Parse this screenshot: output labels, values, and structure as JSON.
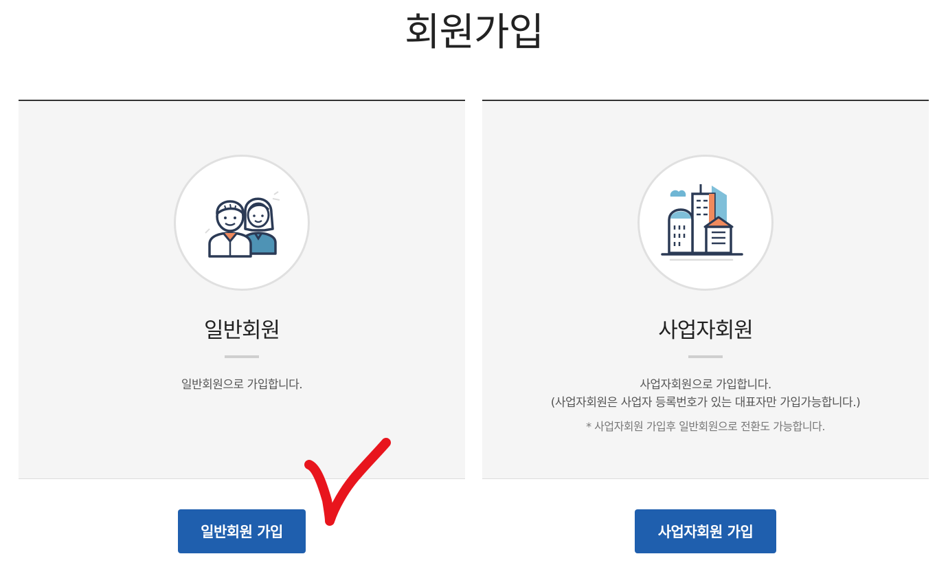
{
  "page": {
    "title": "회원가입"
  },
  "personal": {
    "icon": "people-icon",
    "title": "일반회원",
    "desc_lines": [
      "일반회원으로 가입합니다."
    ],
    "button_label": "일반회원 가입"
  },
  "business": {
    "icon": "buildings-icon",
    "title": "사업자회원",
    "desc_lines": [
      "사업자회원으로 가입합니다.",
      "(사업자회원은 사업자 등록번호가 있는 대표자만 가입가능합니다.)"
    ],
    "note": "* 사업자회원 가입후 일반회원으로 전환도 가능합니다.",
    "button_label": "사업자회원 가입"
  },
  "colors": {
    "button": "#1f5fae",
    "annotation": "#e8151d",
    "card_bg": "#f5f5f5"
  }
}
